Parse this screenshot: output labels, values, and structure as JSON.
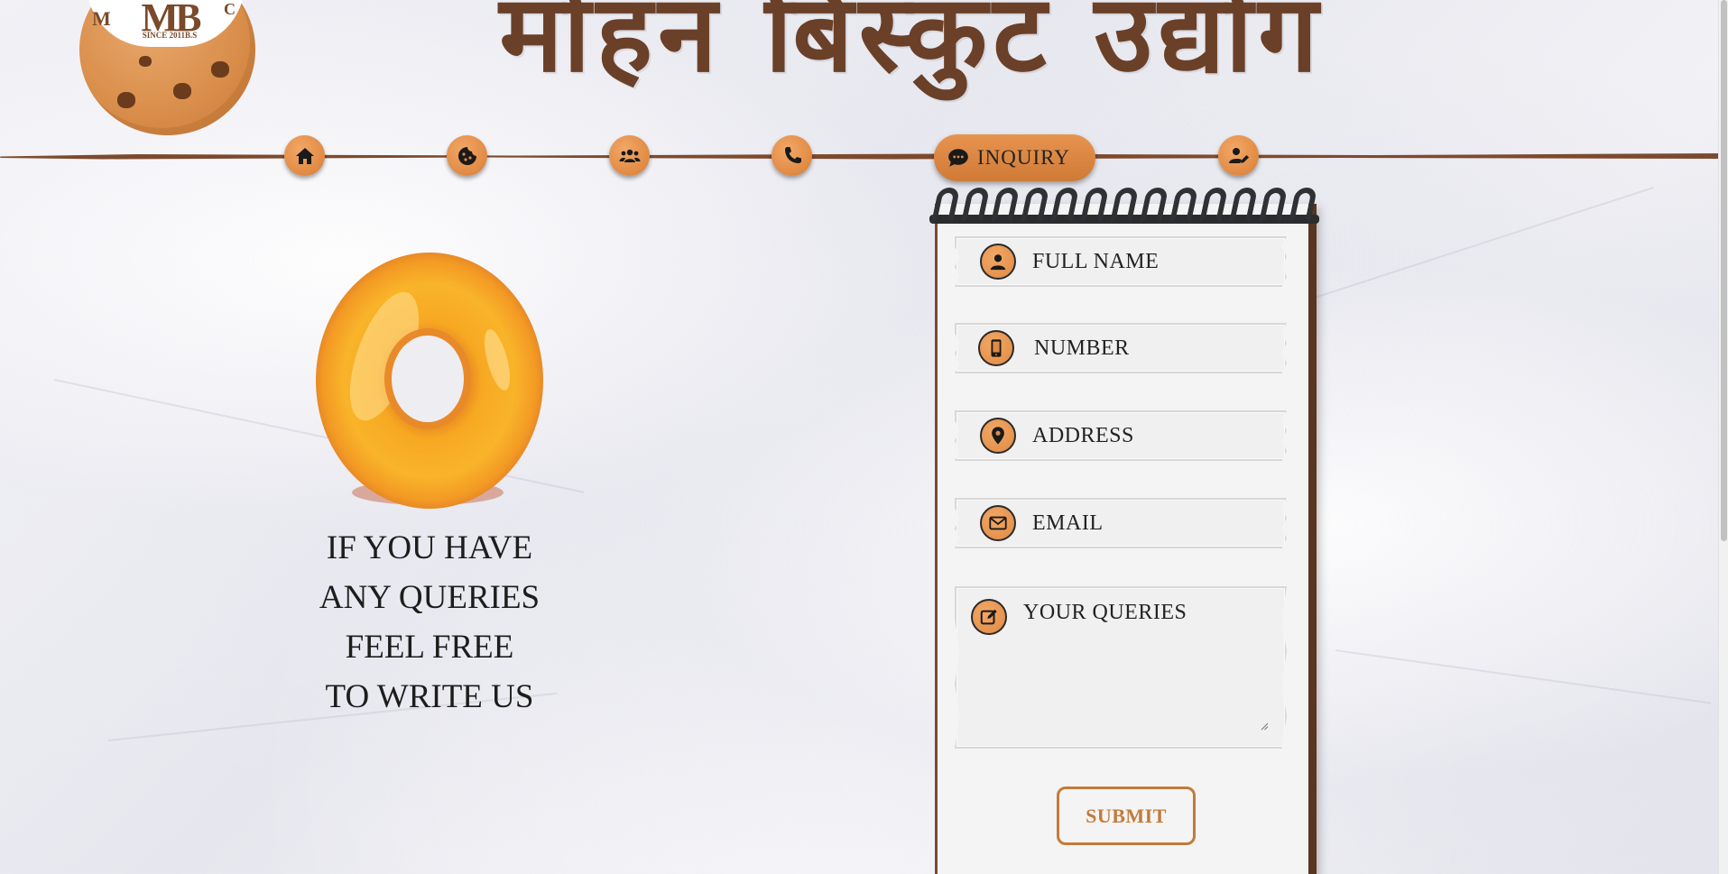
{
  "header": {
    "logo_text": "MB",
    "logo_since": "SINCE 2011B.S",
    "logo_edge_left": "M",
    "logo_edge_right": "C",
    "brand_title": "मोहन बिस्कुट उद्योग"
  },
  "nav": {
    "items": [
      {
        "icon": "home-icon"
      },
      {
        "icon": "cookie-icon"
      },
      {
        "icon": "users-icon"
      },
      {
        "icon": "phone-icon"
      },
      {
        "icon": "comment-icon",
        "label": "INQUIRY",
        "active": true
      },
      {
        "icon": "user-edit-icon"
      }
    ],
    "active_label": "INQUIRY"
  },
  "hero": {
    "illustration": "donut-icon",
    "tagline": [
      "IF YOU HAVE",
      "ANY QUERIES",
      "FEEL FREE",
      "TO WRITE US"
    ]
  },
  "form": {
    "fields": {
      "full_name": {
        "placeholder": "FULL NAME",
        "icon": "user-icon"
      },
      "number": {
        "placeholder": "NUMBER",
        "icon": "mobile-icon"
      },
      "address": {
        "placeholder": "ADDRESS",
        "icon": "location-pin-icon"
      },
      "email": {
        "placeholder": "EMAIL",
        "icon": "envelope-icon"
      },
      "queries": {
        "placeholder": "YOUR QUERIES",
        "icon": "edit-icon"
      }
    },
    "submit_label": "SUBMIT"
  },
  "colors": {
    "accent": "#e08a44",
    "brown": "#7d4a2e",
    "text": "#222222",
    "submit": "#c47a3a"
  }
}
